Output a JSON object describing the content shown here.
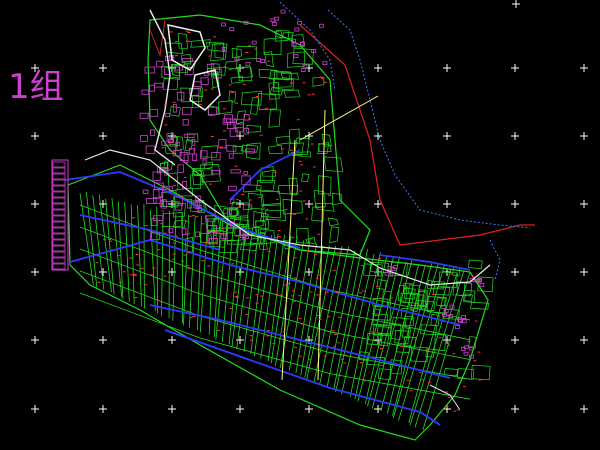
{
  "canvas": {
    "background": "#000000"
  },
  "map_label": {
    "text": "1组",
    "color": "#d040d0"
  },
  "colors": {
    "parcel": "#22dd22",
    "building": "#d040d0",
    "road": "#2c3cff",
    "stream": "#3c78ff",
    "boundary": "#e02020",
    "survey_line": "#ffff80",
    "path": "#e8e8e8",
    "marker": "#ff3030",
    "grid_cross": "#ffffff"
  },
  "icons": {
    "grid_cross": "plus-sign",
    "parcel_marker": "red-dash"
  }
}
